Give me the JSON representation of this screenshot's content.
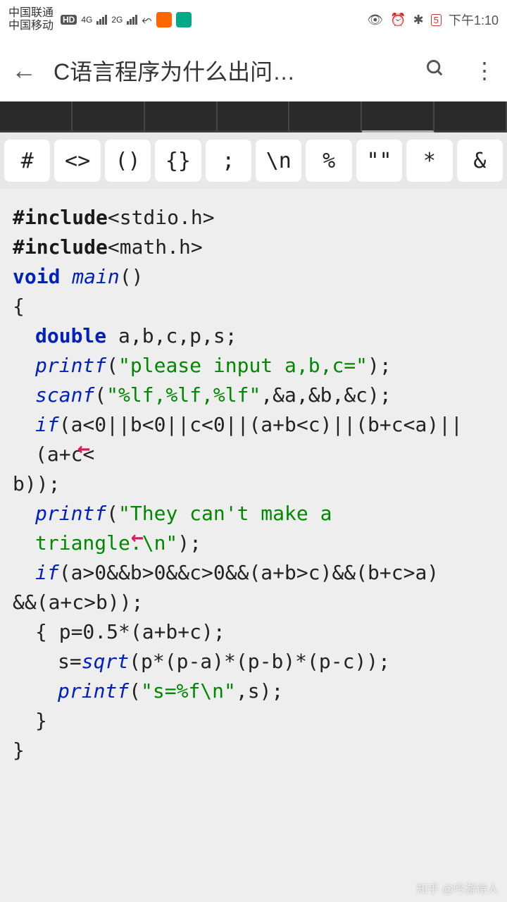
{
  "status": {
    "carrier1": "中国联通",
    "carrier2": "中国移动",
    "hd": "HD",
    "net1": "4G",
    "net2": "2G",
    "battery": "5",
    "time": "下午1:10"
  },
  "header": {
    "title": "C语言程序为什么出问…"
  },
  "symbols": [
    "#",
    "<>",
    "()",
    "{}",
    ";",
    "\\n",
    "%",
    "\"\"",
    "*",
    "&"
  ],
  "code": {
    "l1_kw": "#include",
    "l1_hdr": "<stdio.h>",
    "l2_kw": "#include",
    "l2_hdr": "<math.h>",
    "l3_void": "void ",
    "l3_main": "main",
    "l3_paren": "()",
    "l4": "{",
    "l5_kw": "double ",
    "l5_rest": "a,b,c,p,s;",
    "l6_fn": "printf",
    "l6_open": "(",
    "l6_str": "\"please input a,b,c=\"",
    "l6_close": ");",
    "l7_fn": "scanf",
    "l7_open": "(",
    "l7_str": "\"%lf,%lf,%lf\"",
    "l7_rest": ",&a,&b,&c);",
    "l8_kw": "if",
    "l8_rest": "(a<0||b<0||c<0||(a+b<c)||(b+c<a)||(a+c<",
    "l8b": "b));",
    "l9_fn": "printf",
    "l9_open": "(",
    "l9_str": "\"They can't make a triangle.\\n\"",
    "l9_close": ");",
    "l10_kw": "if",
    "l10_rest": "(a>0&&b>0&&c>0&&(a+b>c)&&(b+c>a)",
    "l10b": "&&(a+c>b));",
    "l11": "{  p=0.5*(a+b+c);",
    "l12a": "s=",
    "l12_fn": "sqrt",
    "l12b": "(p*(p-a)*(p-b)*(p-c));",
    "l13_fn": "printf",
    "l13_open": "(",
    "l13_str": "\"s=%f\\n\"",
    "l13_rest": ",s);",
    "l14": "}",
    "l15": "}"
  },
  "arrows": {
    "a1": "←",
    "a2": "←"
  },
  "watermark": "知乎 @吟游诗人"
}
